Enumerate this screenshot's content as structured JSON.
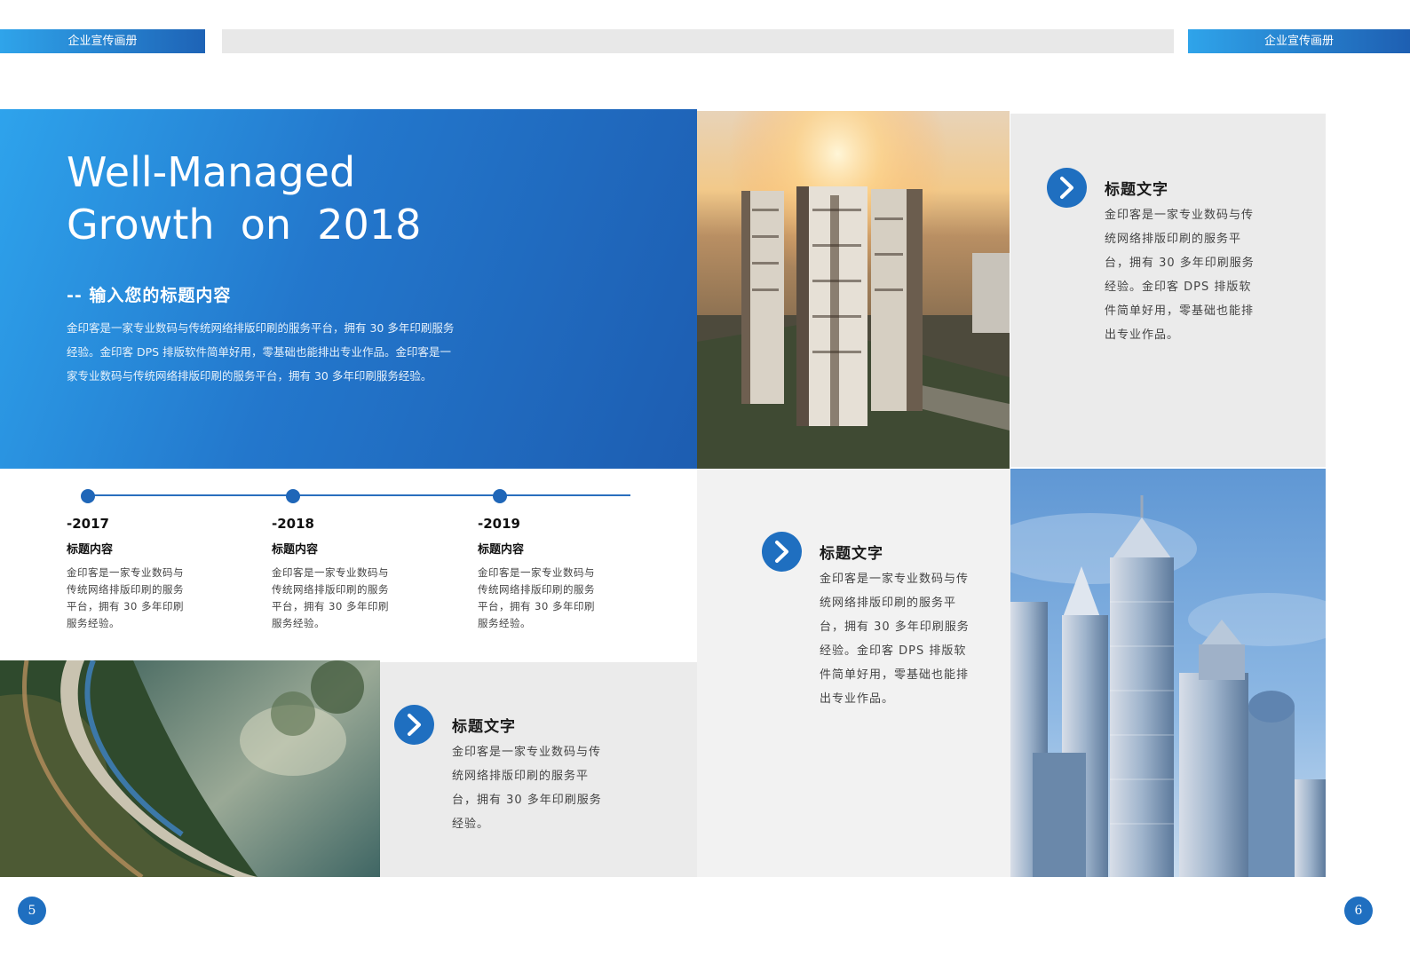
{
  "header": {
    "left_tab": "企业宣传画册",
    "right_tab": "企业宣传画册"
  },
  "hero": {
    "title_line1": "Well-Managed",
    "title_line2": "Growth  on  2018",
    "subtitle": "-- 输入您的标题内容",
    "body": "金印客是一家专业数码与传统网络排版印刷的服务平台，拥有 30 多年印刷服务经验。金印客 DPS 排版软件简单好用，零基础也能排出专业作品。金印客是一家专业数码与传统网络排版印刷的服务平台，拥有 30 多年印刷服务经验。"
  },
  "timeline": [
    {
      "year": "-2017",
      "heading": "标题内容",
      "body": "金印客是一家专业数码与传统网络排版印刷的服务平台，拥有 30 多年印刷服务经验。"
    },
    {
      "year": "-2018",
      "heading": "标题内容",
      "body": "金印客是一家专业数码与传统网络排版印刷的服务平台，拥有 30 多年印刷服务经验。"
    },
    {
      "year": "-2019",
      "heading": "标题内容",
      "body": "金印客是一家专业数码与传统网络排版印刷的服务平台，拥有 30 多年印刷服务经验。"
    }
  ],
  "cards": {
    "top_right": {
      "title": "标题文字",
      "body": "金印客是一家专业数码与传统网络排版印刷的服务平台，拥有 30 多年印刷服务经验。金印客 DPS 排版软件简单好用，零基础也能排出专业作品。"
    },
    "middle": {
      "title": "标题文字",
      "body": "金印客是一家专业数码与传统网络排版印刷的服务平台，拥有 30 多年印刷服务经验。金印客 DPS 排版软件简单好用，零基础也能排出专业作品。"
    },
    "bottom": {
      "title": "标题文字",
      "body": "金印客是一家专业数码与传统网络排版印刷的服务平台，拥有 30 多年印刷服务经验。"
    }
  },
  "page_numbers": {
    "left": "5",
    "right": "6"
  },
  "colors": {
    "accent_blue": "#1f6fc0",
    "gradient_light": "#2ea3ec",
    "gradient_dark": "#1d5db1",
    "panel_grey": "#ebebeb"
  },
  "icons": [
    "chevron-right-icon"
  ]
}
